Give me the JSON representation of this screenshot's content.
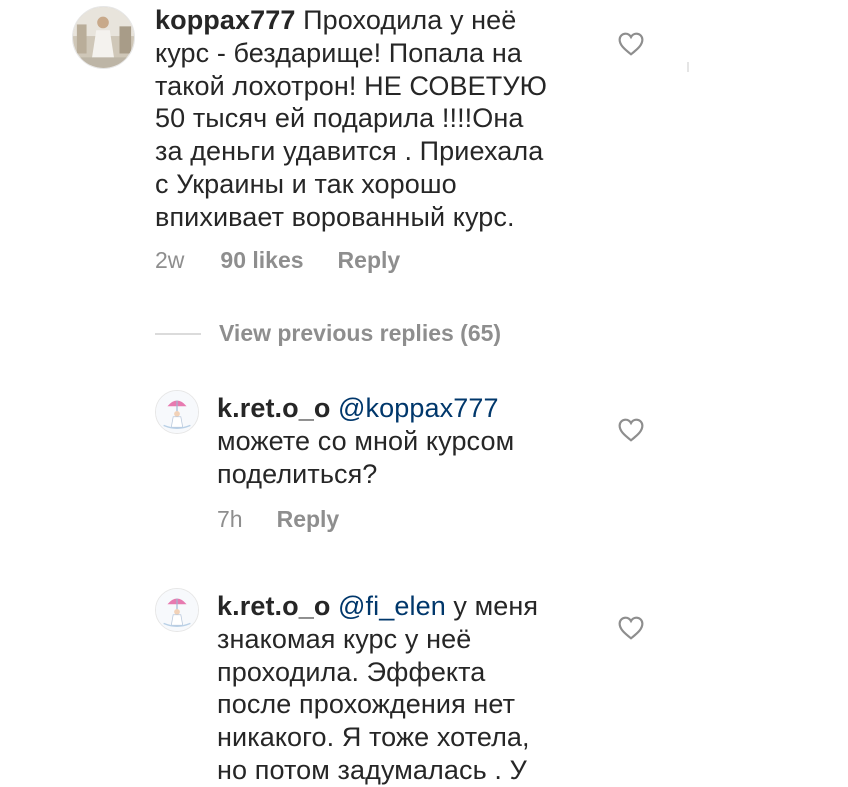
{
  "comments": [
    {
      "username": "koppax777",
      "text": "Проходила у неё\nкурс - бездарище! Попала на\nтакой лохотрон! НЕ СОВЕТУЮ\n50 тысяч ей подарила !!!!Она\nза деньги удавится . Приехала\nс Украины и так хорошо\nвпихивает ворованный курс.",
      "time": "2w",
      "likes": "90 likes",
      "reply": "Reply"
    }
  ],
  "view_previous": "View previous replies (65)",
  "replies": [
    {
      "username": "k.ret.o_o",
      "mention": "@koppax777",
      "text": "\nможете со мной курсом\nподелиться?",
      "time": "7h",
      "reply": "Reply"
    },
    {
      "username": "k.ret.o_o",
      "mention": "@fi_elen",
      "text": " у меня\nзнакомая курс у неё\nпроходила. Эффекта\nпосле прохождения нет\nникакого. Я тоже хотела,\nно потом задумалась . У"
    }
  ],
  "icons": {
    "like": "heart-outline-icon",
    "avatar_main": "avatar-photo",
    "avatar_reply": "avatar-umbrella-drawing"
  }
}
